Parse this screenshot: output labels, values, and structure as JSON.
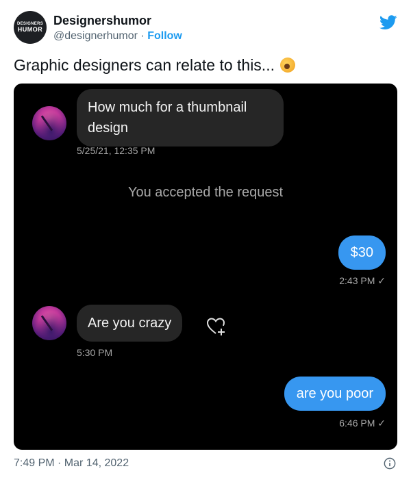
{
  "tweet": {
    "avatar_line1": "DESIGNERS",
    "avatar_line2": "HUMOR",
    "author_name": "Designershumor",
    "handle": "@designerhumor",
    "separator": "·",
    "follow_label": "Follow",
    "text": "Graphic designers can relate to this...",
    "footer_time": "7:49 PM · Mar 14, 2022"
  },
  "conversation": {
    "msg1": "How much for a thumbnail design",
    "msg1_time": "5/25/21, 12:35 PM",
    "status": "You accepted the request",
    "msg2": "$30",
    "msg2_time": "2:43 PM ✓",
    "msg3": "Are you crazy",
    "msg3_time": "5:30 PM",
    "msg4": "are you poor",
    "msg4_time": "6:46 PM ✓"
  },
  "colors": {
    "brand": "#1d9bf0",
    "chat_bg": "#000000",
    "incoming_bubble": "#262626",
    "outgoing_bubble": "#3797f0"
  },
  "icons": [
    "twitter-bird-icon",
    "heart-add-icon",
    "info-icon"
  ]
}
